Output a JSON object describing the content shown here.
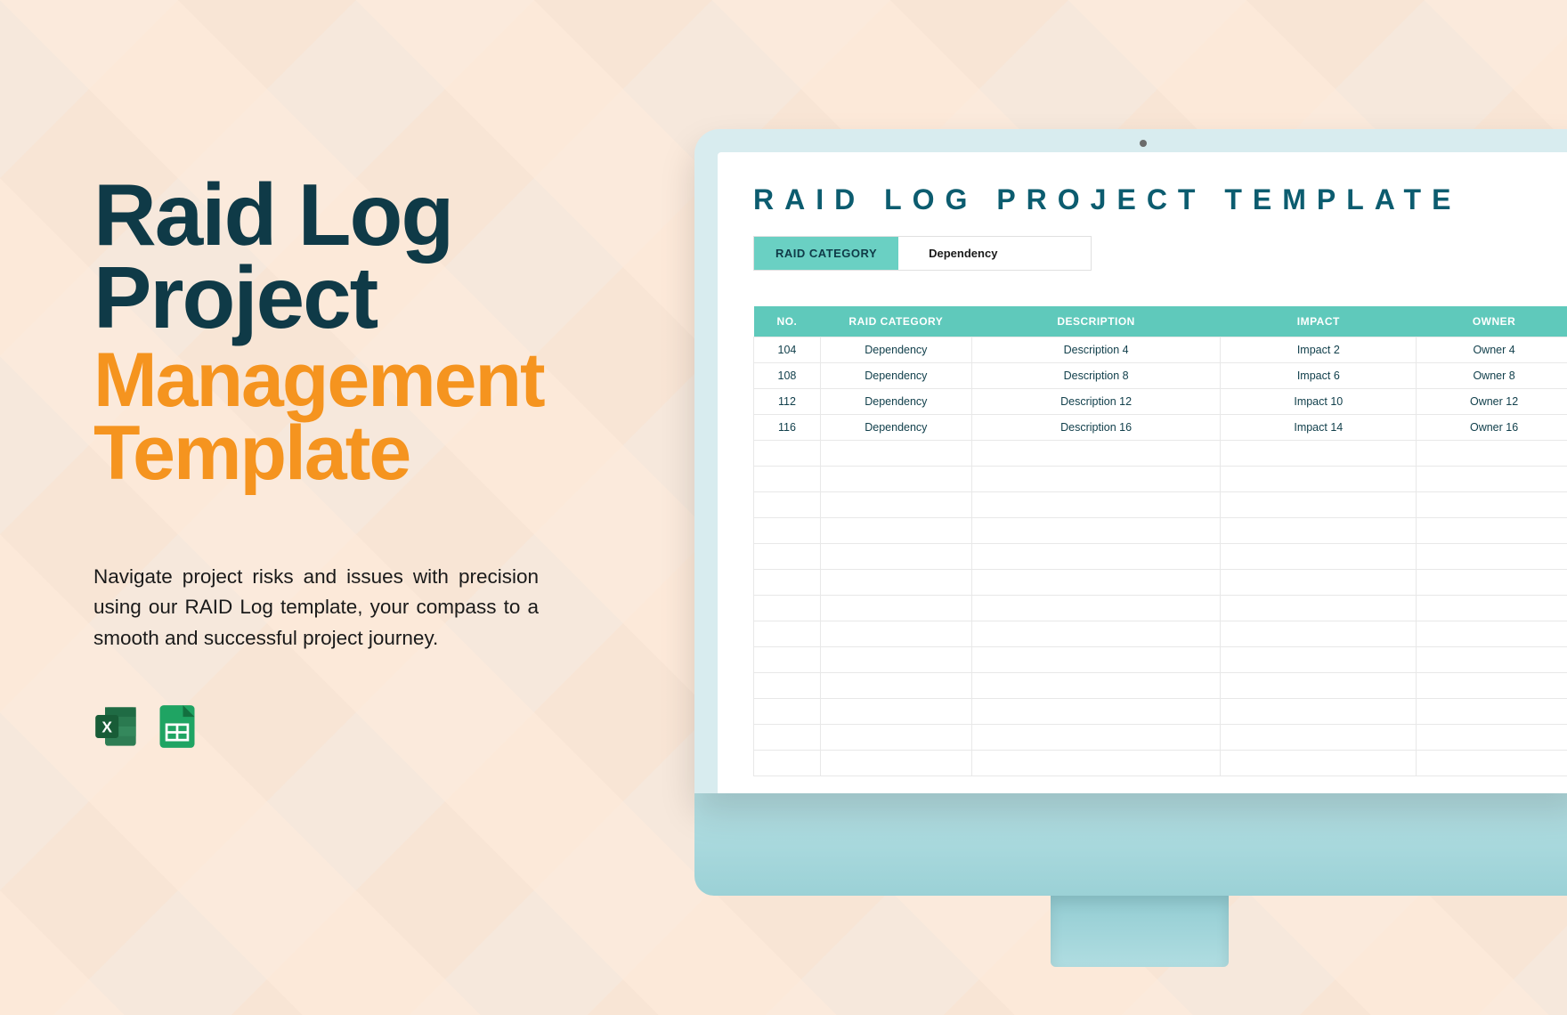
{
  "headline": {
    "line1": "Raid Log",
    "line2": "Project",
    "line3": "Management",
    "line4": "Template"
  },
  "description": "Navigate project risks and issues with precision using our RAID Log template, your compass to a smooth and successful project journey.",
  "icons": {
    "excel": "excel-icon",
    "sheets": "google-sheets-icon"
  },
  "screen": {
    "title": "RAID LOG PROJECT TEMPLATE",
    "filter": {
      "label": "RAID CATEGORY",
      "value": "Dependency"
    },
    "columns": [
      "NO.",
      "RAID CATEGORY",
      "DESCRIPTION",
      "IMPACT",
      "OWNER"
    ],
    "rows": [
      {
        "no": "104",
        "cat": "Dependency",
        "desc": "Description 4",
        "imp": "Impact 2",
        "own": "Owner 4"
      },
      {
        "no": "108",
        "cat": "Dependency",
        "desc": "Description 8",
        "imp": "Impact 6",
        "own": "Owner 8"
      },
      {
        "no": "112",
        "cat": "Dependency",
        "desc": "Description 12",
        "imp": "Impact 10",
        "own": "Owner 12"
      },
      {
        "no": "116",
        "cat": "Dependency",
        "desc": "Description 16",
        "imp": "Impact 14",
        "own": "Owner 16"
      }
    ],
    "empty_rows": 13
  },
  "colors": {
    "dark_teal": "#0f3a47",
    "orange": "#f5941f",
    "teal_header": "#5fc9bb",
    "teal_button": "#6ad0c3"
  }
}
